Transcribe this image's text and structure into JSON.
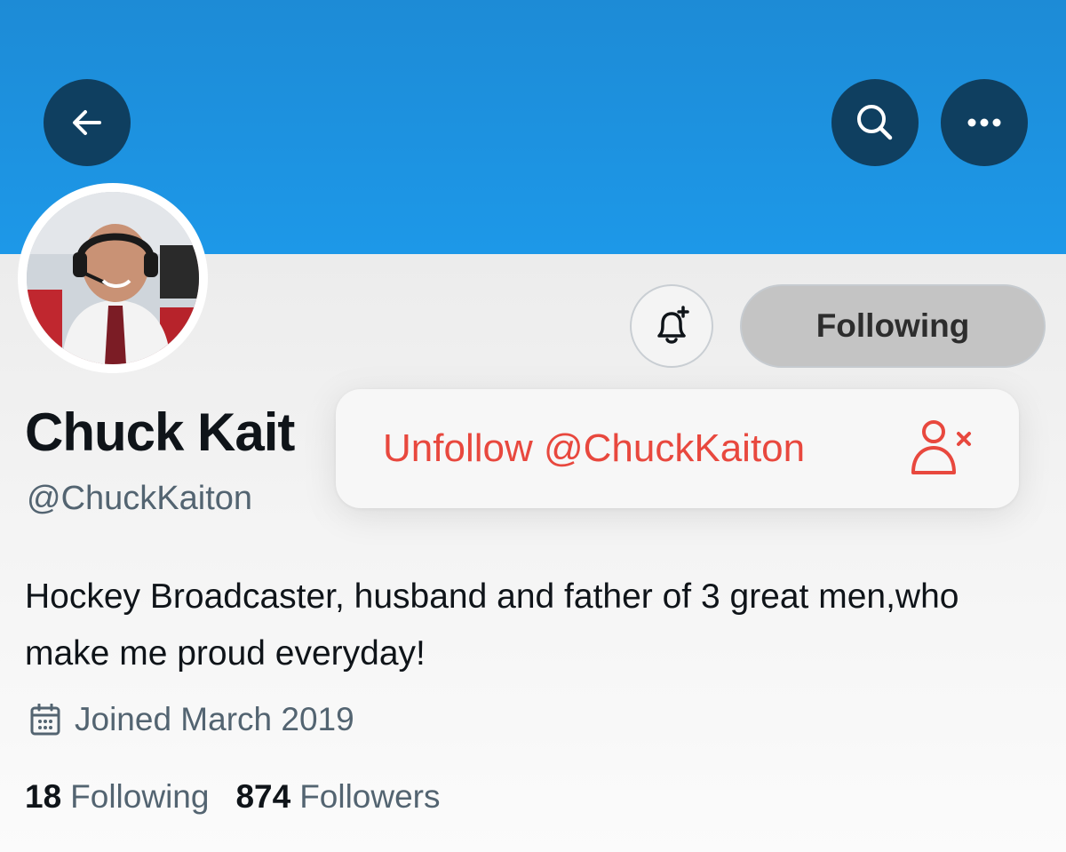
{
  "profile": {
    "display_name": "Chuck Kait",
    "handle": "@ChuckKaiton",
    "bio": "Hockey Broadcaster, husband and father of 3 great men,who make me proud everyday!",
    "joined": "Joined March 2019",
    "stats": {
      "following_count": "18",
      "following_label": "Following",
      "followers_count": "874",
      "followers_label": "Followers"
    }
  },
  "header": {
    "back_icon": "arrow-left-icon",
    "search_icon": "search-icon",
    "more_icon": "more-horizontal-icon"
  },
  "actions": {
    "notify_icon": "bell-plus-icon",
    "following_label": "Following"
  },
  "menu": {
    "unfollow_label": "Unfollow @ChuckKaiton",
    "unfollow_icon": "person-remove-icon"
  },
  "colors": {
    "banner": "#1d98e8",
    "header_button": "#0f3f60",
    "destructive": "#e8483e",
    "secondary_text": "#536471"
  }
}
